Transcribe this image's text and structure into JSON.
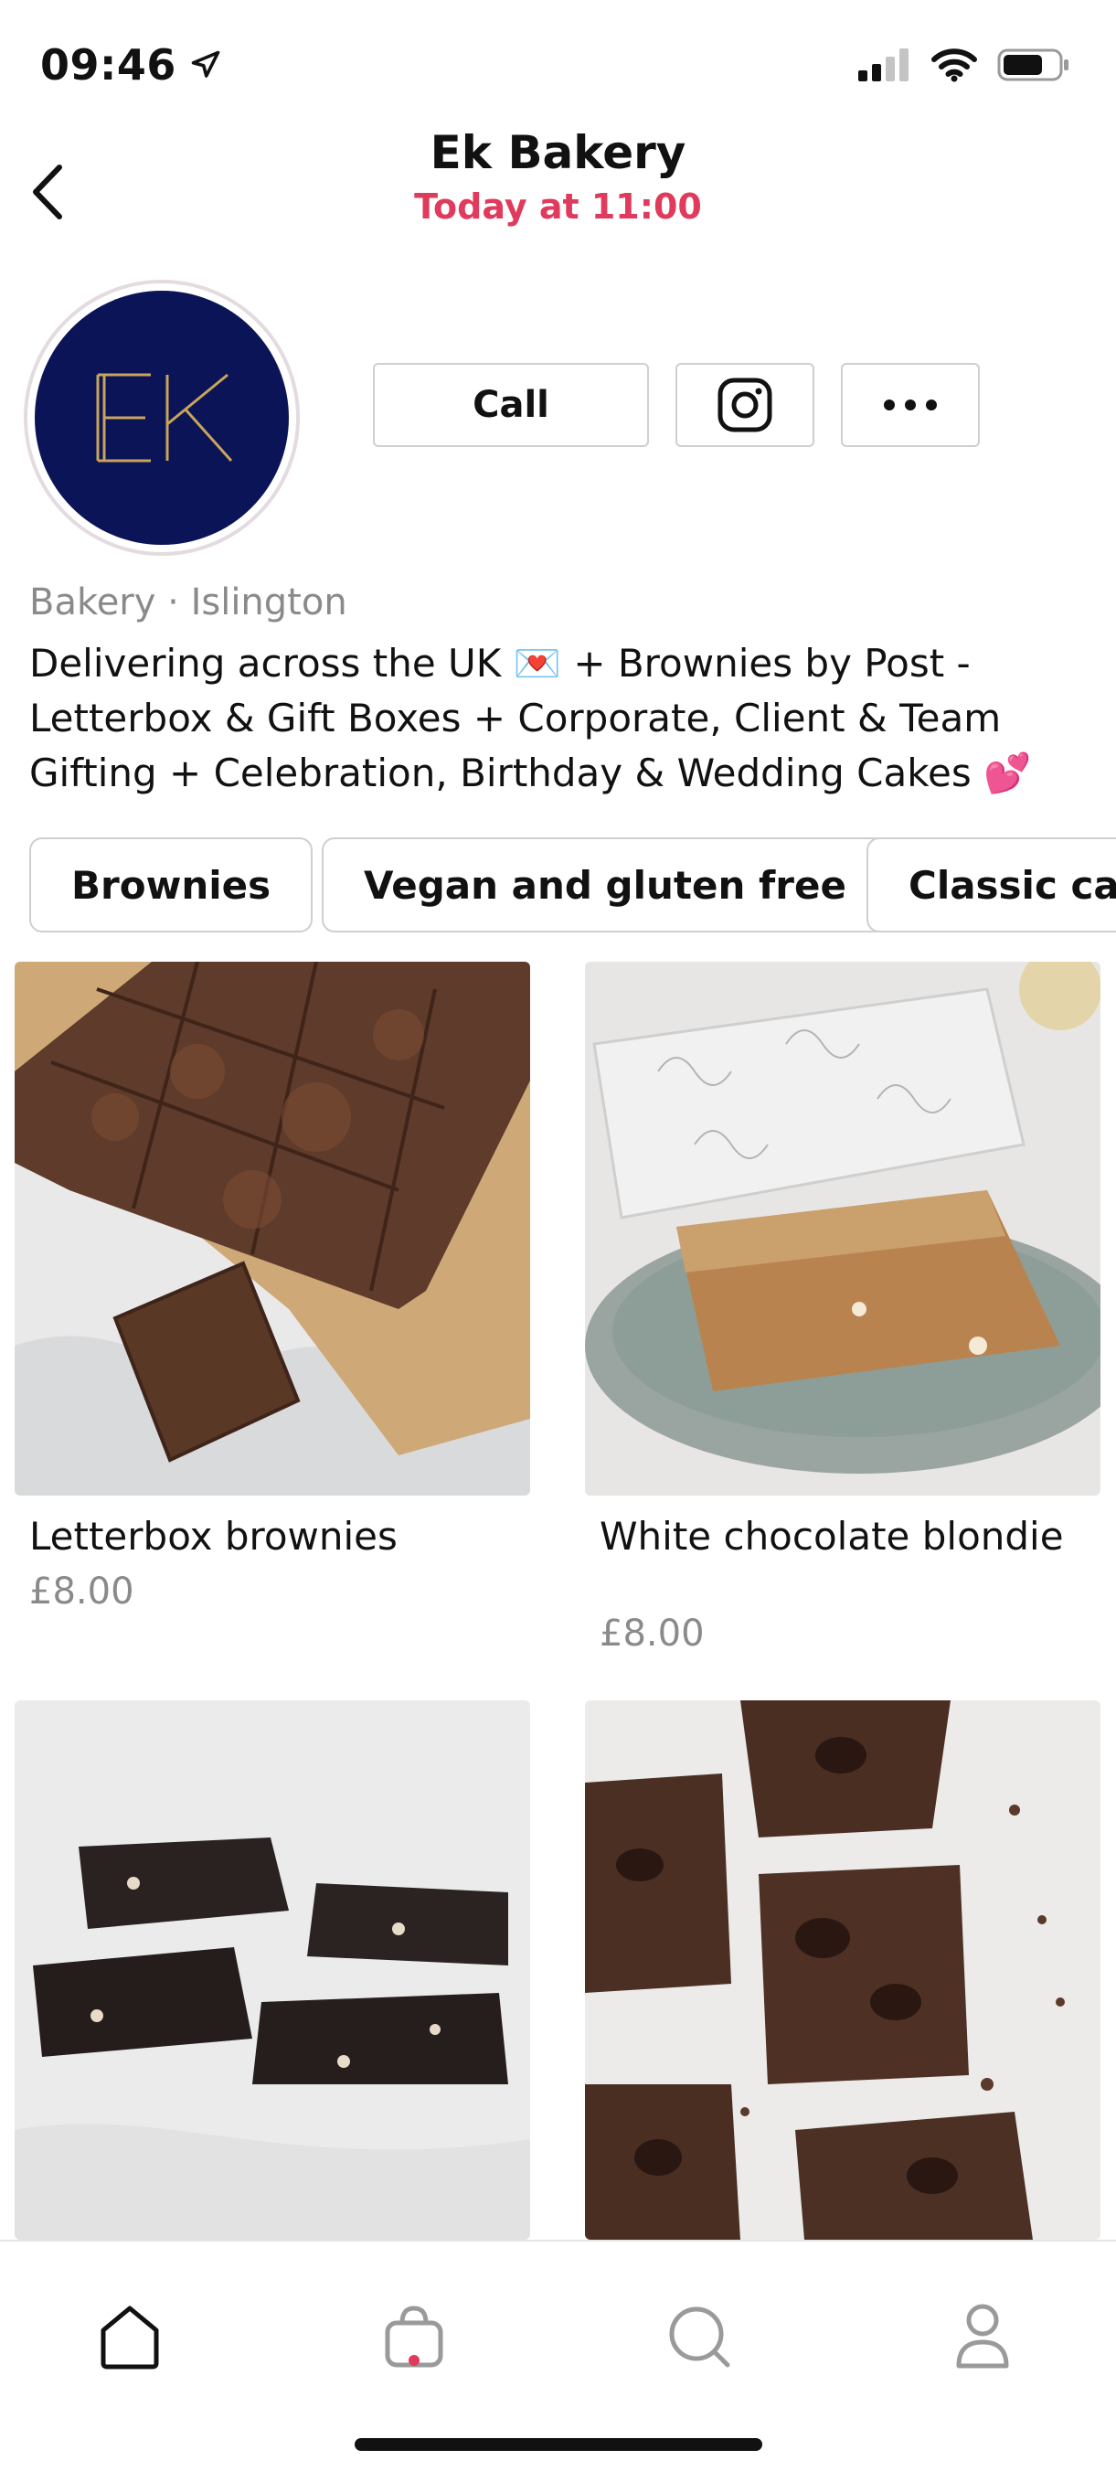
{
  "status_bar": {
    "time": "09:46",
    "icons": [
      "location-arrow-icon",
      "signal-icon",
      "wifi-icon",
      "battery-icon"
    ]
  },
  "header": {
    "title": "Ek Bakery",
    "subtitle": "Today at 11:00",
    "back_icon": "chevron-left-icon"
  },
  "profile": {
    "avatar_text": "EK",
    "avatar_bg": "#0b1456",
    "avatar_fg": "#c8a45c",
    "call_label": "Call",
    "instagram_icon": "instagram-icon",
    "more_icon": "more-dots-icon",
    "category_line": "Bakery · Islington",
    "bio": "Delivering across the UK 💌 + Brownies by Post - Letterbox & Gift Boxes + Corporate, Client & Team Gifting + Celebration, Birthday & Wedding Cakes 💕"
  },
  "chips": [
    {
      "label": "Brownies"
    },
    {
      "label": "Vegan and gluten free"
    },
    {
      "label": "Classic cakes"
    }
  ],
  "products": [
    {
      "name": "Letterbox brownies",
      "price": "£8.00"
    },
    {
      "name": "White chocolate blondie",
      "price": "£8.00"
    },
    {
      "name": "",
      "price": ""
    },
    {
      "name": "",
      "price": ""
    }
  ],
  "tab_bar": {
    "tabs": [
      {
        "icon": "home-icon",
        "active": true
      },
      {
        "icon": "shopping-bag-icon",
        "active": false,
        "badge": true
      },
      {
        "icon": "search-icon",
        "active": false
      },
      {
        "icon": "profile-icon",
        "active": false
      }
    ]
  },
  "colors": {
    "accent": "#e03a5c",
    "text": "#111111",
    "muted": "#8a8a8a"
  }
}
